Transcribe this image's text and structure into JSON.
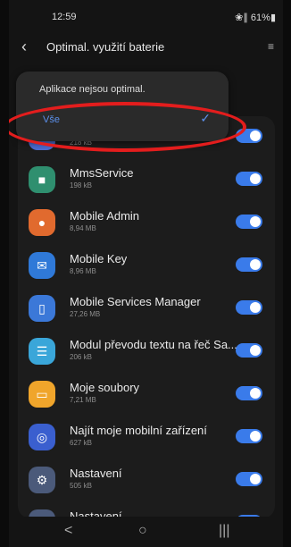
{
  "status": {
    "time": "12:59",
    "right": "❀∥ 61%▮"
  },
  "header": {
    "back_icon": "chevron-left-icon",
    "title": "Optimal. využití baterie",
    "sort_icon": "sort-icon"
  },
  "dropdown": {
    "options": [
      "Aplikace nejsou optimal.",
      "Vše"
    ],
    "selected": "Vše"
  },
  "apps": [
    {
      "name": "",
      "size": "218 kB",
      "icon": "",
      "color": "#4b6bd1"
    },
    {
      "name": "MmsService",
      "size": "198 kB",
      "icon": "■",
      "color": "#2f8f6f"
    },
    {
      "name": "Mobile Admin",
      "size": "8,94 MB",
      "icon": "●",
      "color": "#e16a2e"
    },
    {
      "name": "Mobile Key",
      "size": "8,96 MB",
      "icon": "✉",
      "color": "#2f79d8"
    },
    {
      "name": "Mobile Services Manager",
      "size": "27,26 MB",
      "icon": "▯",
      "color": "#3b78d8"
    },
    {
      "name": "Modul převodu textu na řeč Sa...",
      "size": "206 kB",
      "icon": "☰",
      "color": "#3aa6d9"
    },
    {
      "name": "Moje soubory",
      "size": "7,21 MB",
      "icon": "▭",
      "color": "#f0a52b"
    },
    {
      "name": "Najít moje mobilní zařízení",
      "size": "627 kB",
      "icon": "◎",
      "color": "#3a5fcf"
    },
    {
      "name": "Nastavení",
      "size": "505 kB",
      "icon": "⚙",
      "color": "#4b5a7a"
    },
    {
      "name": "Nastavení",
      "size": "",
      "icon": "⚙",
      "color": "#4b5a7a"
    }
  ],
  "navbar": {
    "back": "<",
    "home": "○",
    "recents": "|||"
  }
}
